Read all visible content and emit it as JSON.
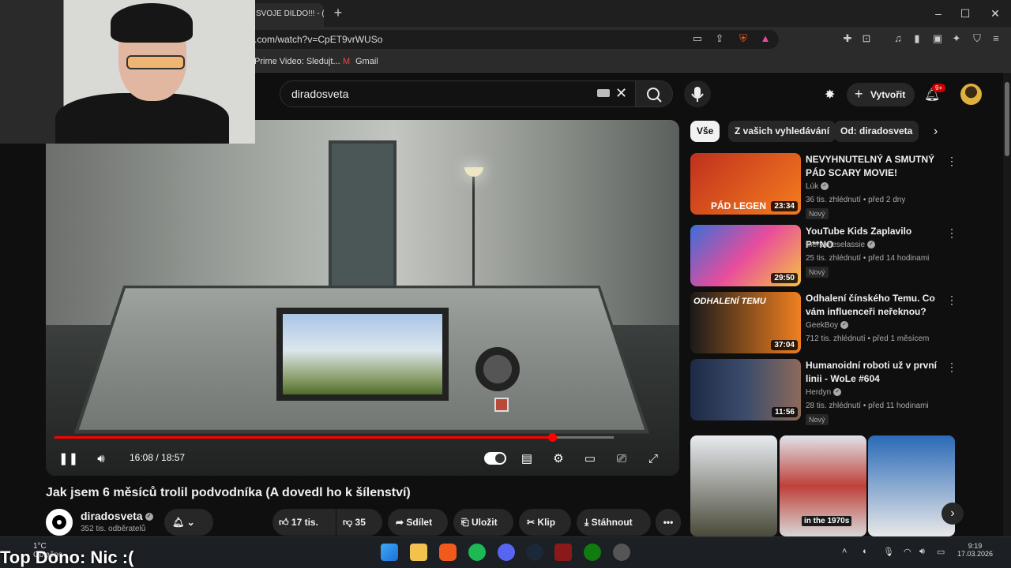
{
  "browser": {
    "tab_title": "SVOJE DILDO!!! - (",
    "new_tab": "+",
    "url": ".com/watch?v=CpET9vrWUSo",
    "window_controls": [
      "–",
      "☐",
      "✕"
    ],
    "bookmarks": [
      "Prime Video: Sledujt...",
      "Gmail"
    ],
    "ext_badge": "9+"
  },
  "youtube": {
    "search_query": "diradosveta",
    "create_label": "Vytvořit",
    "notif_badge": "9+"
  },
  "player": {
    "time": "16:08 / 18:57",
    "progress": 0.89,
    "buffer": 0.98
  },
  "video": {
    "title": "Jak jsem 6 měsíců trolil podvodníka (A dovedl ho k šílenství)",
    "channel": "diradosveta",
    "subscribers": "352 tis. odběratelů",
    "likes": "17 tis.",
    "dislikes": "35",
    "share": "Sdílet",
    "save": "Uložit",
    "clip": "Klip",
    "download": "Stáhnout"
  },
  "chips": [
    "Vše",
    "Z vašich vyhledávání",
    "Od: diradosveta"
  ],
  "recommendations": [
    {
      "title": "NEVYHNUTELNÝ A SMUTNÝ PÁD SCARY MOVIE!",
      "channel": "Lúk",
      "meta": "36 tis. zhlédnutí • před 2 dny",
      "badge": "Nový",
      "duration": "23:34",
      "thumb_text": "PÁD LEGEN",
      "color": "#c0301d"
    },
    {
      "title": "YouTube Kids Zaplavilo P**NO",
      "channel": "menameselassie",
      "meta": "25 tis. zhlédnutí • před 14 hodinami",
      "badge": "Nový",
      "duration": "29:50",
      "thumb_text": "",
      "color": "#3b6fd8"
    },
    {
      "title": "Odhalení čínského Temu. Co vám influenceři neřeknou?",
      "channel": "GeekBoy",
      "meta": "712 tis. zhlédnutí • před 1 měsícem",
      "badge": "",
      "duration": "37:04",
      "thumb_text": "ODHALENÍ TEMU",
      "color": "#1a1a1a"
    },
    {
      "title": "Humanoidní roboti už v první linii - WoLe #604",
      "channel": "Herdyn",
      "meta": "28 tis. zhlédnutí • před 11 hodinami",
      "badge": "Nový",
      "duration": "11:56",
      "thumb_text": "",
      "color": "#1e2a44"
    }
  ],
  "shorts_label": "in the 1970s",
  "taskbar": {
    "weather_temp": "1°C",
    "weather_desc": "Oblačno",
    "overlay_text": "Top Dono: Nic :(",
    "time": "9:19",
    "date": "17.03.2026"
  }
}
